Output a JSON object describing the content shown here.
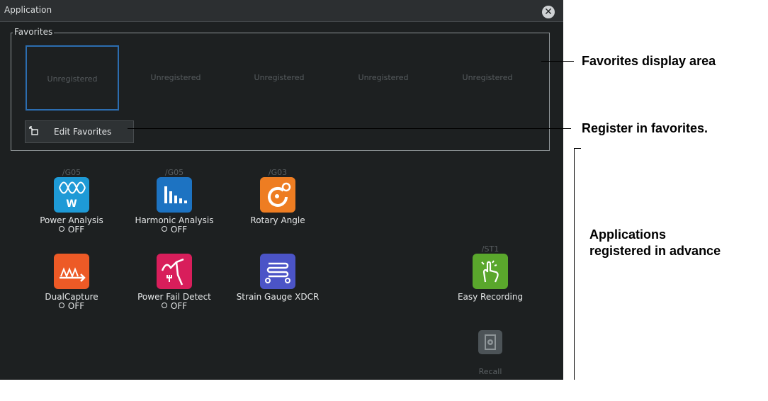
{
  "window": {
    "title": "Application"
  },
  "favorites": {
    "group_label": "Favorites",
    "slots": [
      "Unregistered",
      "Unregistered",
      "Unregistered",
      "Unregistered",
      "Unregistered"
    ],
    "edit_button_label": "Edit Favorites"
  },
  "apps": [
    {
      "name": "Power Analysis",
      "option": "/G05",
      "status": "OFF",
      "icon": "power-analysis-icon",
      "color": "#1e9ad6"
    },
    {
      "name": "Harmonic Analysis",
      "option": "/G05",
      "status": "OFF",
      "icon": "harmonic-analysis-icon",
      "color": "#1d73c2"
    },
    {
      "name": "Rotary Angle",
      "option": "/G03",
      "status": "",
      "icon": "rotary-angle-icon",
      "color": "#ee7d22"
    },
    {
      "name": "DualCapture",
      "option": "",
      "status": "OFF",
      "icon": "dual-capture-icon",
      "color": "#ed5a26"
    },
    {
      "name": "Power Fail Detect",
      "option": "",
      "status": "OFF",
      "icon": "power-fail-detect-icon",
      "color": "#d81e5b"
    },
    {
      "name": "Strain Gauge XDCR",
      "option": "",
      "status": "",
      "icon": "strain-gauge-icon",
      "color": "#4b54c7"
    },
    {
      "name": "Easy Recording",
      "option": "/ST1",
      "status": "",
      "icon": "easy-recording-icon",
      "color": "#5aa72c"
    }
  ],
  "recall": {
    "label": "Recall",
    "icon": "recall-icon"
  },
  "callouts": {
    "favorites_area": "Favorites display area",
    "register": "Register in favorites.",
    "apps_line1": "Applications",
    "apps_line2": "registered in advance"
  }
}
